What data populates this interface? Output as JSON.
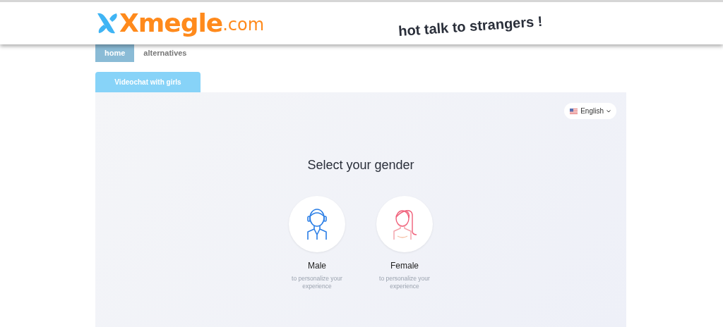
{
  "header": {
    "logo": "Xmegle",
    "logo_suffix": ".com",
    "tagline": "hot talk to strangers !"
  },
  "nav": [
    {
      "label": "home",
      "selected": true
    },
    {
      "label": "alternatives",
      "selected": false
    }
  ],
  "tabs": [
    {
      "label": "Videochat with girls",
      "selected": true
    }
  ],
  "language": {
    "value": "English"
  },
  "heading": "Select your gender",
  "genders": [
    {
      "kind": "male",
      "label": "Male",
      "hint": "to personalize your experience"
    },
    {
      "kind": "female",
      "label": "Female",
      "hint": "to personalize your experience"
    }
  ]
}
